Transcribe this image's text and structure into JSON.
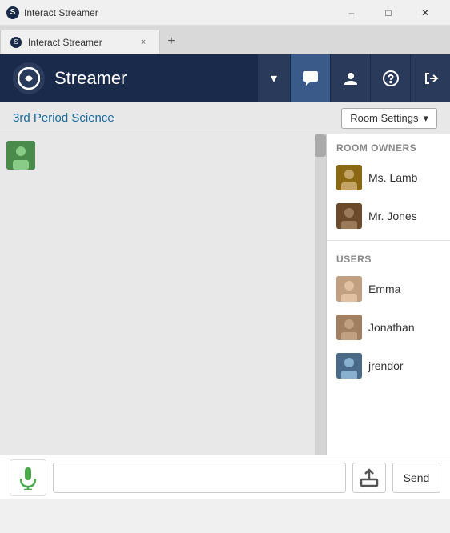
{
  "window": {
    "title": "Interact Streamer",
    "min_label": "–",
    "max_label": "□",
    "close_label": "✕"
  },
  "tab": {
    "label": "Interact Streamer",
    "close": "×",
    "new_tab": "+"
  },
  "header": {
    "logo_text": "S",
    "app_title": "Streamer",
    "dropdown_icon": "▾",
    "actions": [
      {
        "name": "chat-icon",
        "symbol": "💬"
      },
      {
        "name": "person-icon",
        "symbol": "👤"
      },
      {
        "name": "help-icon",
        "symbol": "?"
      },
      {
        "name": "exit-icon",
        "symbol": "⏎"
      }
    ]
  },
  "room_bar": {
    "room_name": "3rd Period Science",
    "settings_label": "Room Settings",
    "settings_arrow": "▾"
  },
  "sidebar": {
    "owners_label": "ROOM OWNERS",
    "users_label": "USERS",
    "owners": [
      {
        "name": "Ms. Lamb",
        "avatar_class": "avatar-lamb"
      },
      {
        "name": "Mr. Jones",
        "avatar_class": "avatar-jones"
      }
    ],
    "users": [
      {
        "name": "Emma",
        "avatar_class": "avatar-emma"
      },
      {
        "name": "Jonathan",
        "avatar_class": "avatar-jonathan"
      },
      {
        "name": "jrendor",
        "avatar_class": "avatar-jrendor"
      }
    ]
  },
  "bottom_bar": {
    "message_placeholder": "",
    "send_label": "Send"
  },
  "icons": {
    "mic": "🎤",
    "upload": "⬆"
  }
}
